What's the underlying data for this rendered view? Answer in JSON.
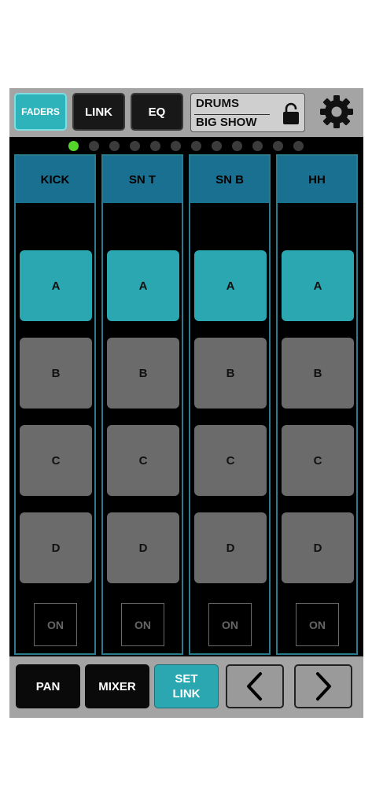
{
  "toolbar": {
    "faders_label": "FADERS",
    "link_label": "LINK",
    "eq_label": "EQ",
    "show_line1": "DRUMS",
    "show_line2": "BIG SHOW",
    "lock_icon": "lock-icon",
    "settings_icon": "gear-icon"
  },
  "pagination": {
    "total": 12,
    "active_index": 0,
    "active_color": "#55d52a"
  },
  "channels": [
    {
      "name": "KICK",
      "pads": [
        "A",
        "B",
        "C",
        "D"
      ],
      "active_pad": "A",
      "on_label": "ON"
    },
    {
      "name": "SN T",
      "pads": [
        "A",
        "B",
        "C",
        "D"
      ],
      "active_pad": "A",
      "on_label": "ON"
    },
    {
      "name": "SN B",
      "pads": [
        "A",
        "B",
        "C",
        "D"
      ],
      "active_pad": "A",
      "on_label": "ON"
    },
    {
      "name": "HH",
      "pads": [
        "A",
        "B",
        "C",
        "D"
      ],
      "active_pad": "A",
      "on_label": "ON"
    }
  ],
  "bottom": {
    "pan_label": "PAN",
    "mixer_label": "MIXER",
    "setlink_line1": "SET",
    "setlink_line2": "LINK",
    "prev_icon": "chevron-left-icon",
    "next_icon": "chevron-right-icon"
  },
  "colors": {
    "accent": "#2aa7b0",
    "header_blue": "#1a7091",
    "inactive_pad": "#6b6b6b",
    "bar_gray": "#a4a4a4"
  }
}
